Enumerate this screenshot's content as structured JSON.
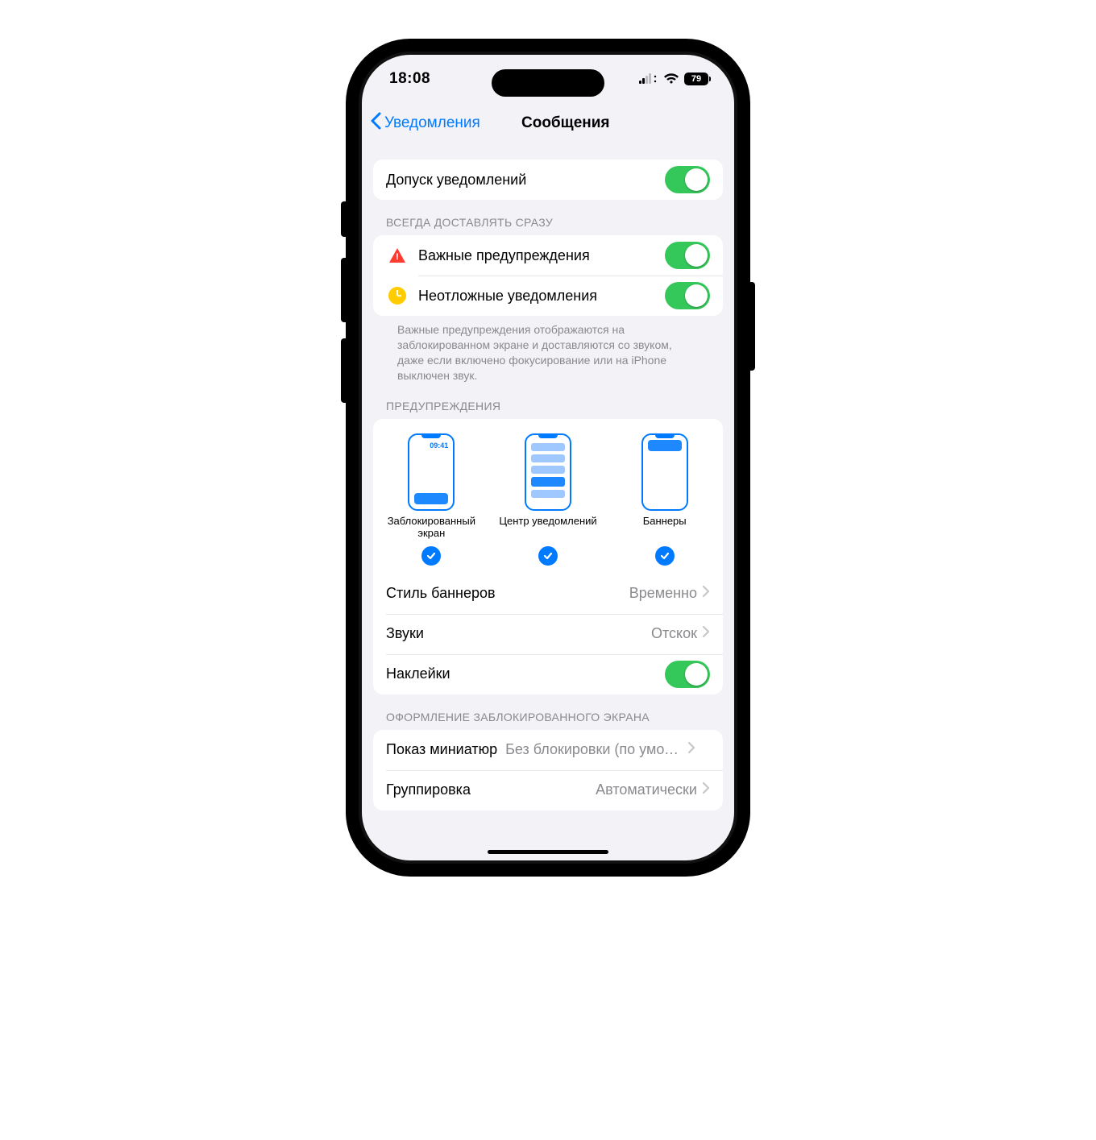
{
  "status": {
    "time": "18:08",
    "battery": "79"
  },
  "nav": {
    "back": "Уведомления",
    "title": "Сообщения"
  },
  "allow": {
    "label": "Допуск уведомлений",
    "on": true
  },
  "always_header": "ВСЕГДА ДОСТАВЛЯТЬ СРАЗУ",
  "always": {
    "critical": {
      "label": "Важные предупреждения",
      "on": true
    },
    "urgent": {
      "label": "Неотложные уведомления",
      "on": true
    }
  },
  "always_footnote": "Важные предупреждения отображаются на заблокированном экране и доставляются со звуком, даже если включено фокусирование или на iPhone выключен звук.",
  "alerts_header": "ПРЕДУПРЕЖДЕНИЯ",
  "previews": {
    "lock": {
      "label": "Заблокированный экран",
      "checked": true,
      "clock": "09:41"
    },
    "center": {
      "label": "Центр уведомлений",
      "checked": true
    },
    "banners": {
      "label": "Баннеры",
      "checked": true
    }
  },
  "rows": {
    "banner_style": {
      "label": "Стиль баннеров",
      "value": "Временно"
    },
    "sounds": {
      "label": "Звуки",
      "value": "Отскок"
    },
    "stickers": {
      "label": "Наклейки",
      "on": true
    }
  },
  "lockscreen_header": "ОФОРМЛЕНИЕ ЗАБЛОКИРОВАННОГО ЭКРАНА",
  "lockscreen": {
    "preview": {
      "label": "Показ миниатюр",
      "value": "Без блокировки (по умол…"
    },
    "grouping": {
      "label": "Группировка",
      "value": "Автоматически"
    }
  }
}
